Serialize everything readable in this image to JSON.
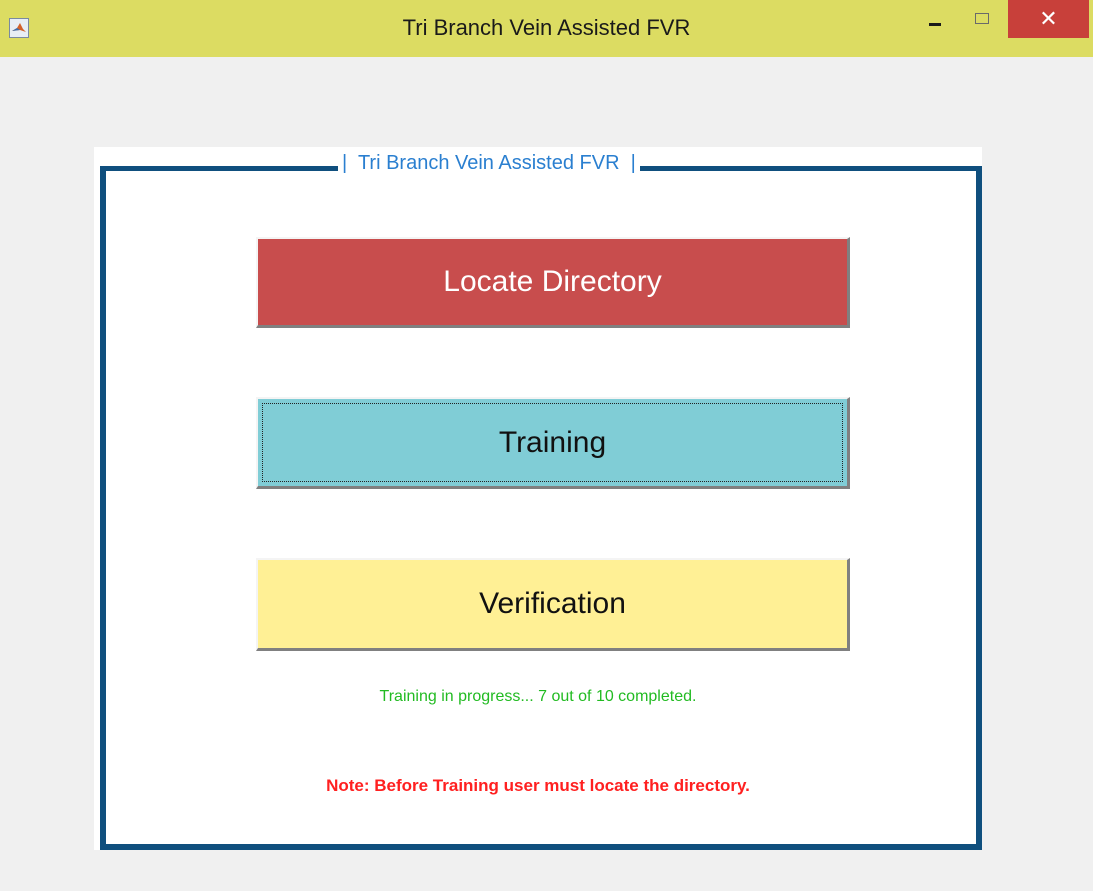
{
  "window": {
    "title": "Tri Branch Vein Assisted FVR",
    "close_glyph": "✕",
    "app_icon": "matlab-logo-icon"
  },
  "panel": {
    "legend": "|  Tri Branch Vein Assisted FVR  |"
  },
  "buttons": {
    "locate_label": "Locate Directory",
    "training_label": "Training",
    "verification_label": "Verification"
  },
  "status": {
    "progress_text": "Training in progress...  7 out of 10 completed.",
    "note_text": "Note: Before Training user must locate the directory."
  },
  "colors": {
    "titlebar": "#dcdc62",
    "panel_border": "#0f4f7e",
    "locate_button": "#c84d4d",
    "training_button": "#80cdd6",
    "verification_button": "#fff095",
    "status_text": "#22bb22",
    "note_text": "#ff2020",
    "legend_text": "#2a7fd0"
  }
}
